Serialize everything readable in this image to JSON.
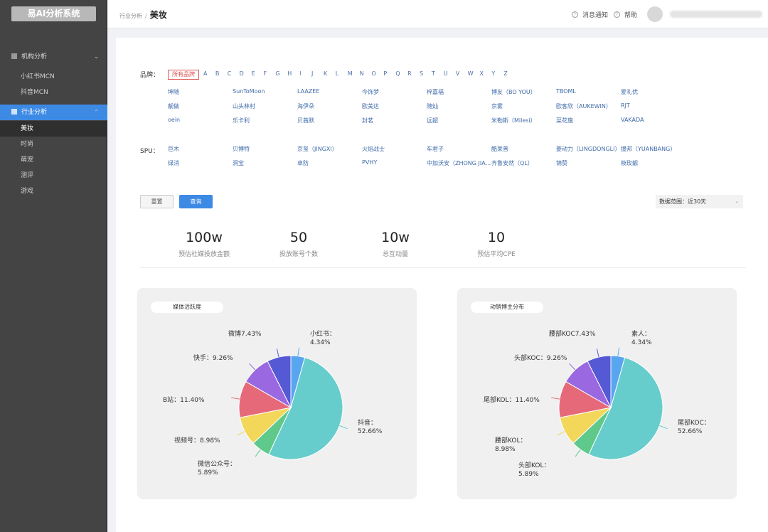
{
  "app": {
    "title": "易AI分析系统"
  },
  "sidebar": {
    "groups": [
      {
        "label": "机构分析",
        "items": [
          "小红书MCN",
          "抖音MCN"
        ]
      },
      {
        "label": "行业分析",
        "items": [
          "美妆",
          "时尚",
          "萌宠",
          "测评",
          "游戏"
        ]
      }
    ],
    "active_item": "美妆"
  },
  "header": {
    "breadcrumb_parent": "行业分析",
    "breadcrumb_separator": "/",
    "breadcrumb_current": "美妆",
    "notify_label": "消息通知",
    "help_label": "帮助"
  },
  "filters": {
    "brand_label": "品牌：",
    "all_brands": "所有品牌",
    "letters": [
      "A",
      "B",
      "C",
      "D",
      "E",
      "F",
      "G",
      "H",
      "I",
      "J",
      "K",
      "L",
      "M",
      "N",
      "O",
      "P",
      "Q",
      "R",
      "S",
      "T",
      "U",
      "V",
      "W",
      "X",
      "Y",
      "Z"
    ],
    "brands": [
      "坤随",
      "SunToMoon",
      "LAAZEE",
      "今饰梦",
      "梓嘉福",
      "博友（BO YOU）",
      "TBOML",
      "爱礼优",
      "靓做",
      "山头林村",
      "海伊朵",
      "欧美达",
      "随灿",
      "京雾",
      "欧客欣（AUKEWIN）",
      "RJT",
      "oein",
      "乐卡利",
      "贝茜默",
      "封茗",
      "远韶",
      "米勒斯（Milesi）",
      "菜花施",
      "VAKADA"
    ],
    "spu_label": "SPU：",
    "spus": [
      "巨木",
      "贝博特",
      "京玺（JINGXI）",
      "火焰战士",
      "车君子",
      "酷莱普",
      "菱动力（LINGDONGLI）",
      "援邦（YUANBANG）",
      "绿消",
      "洞宝",
      "卓防",
      "PVHY",
      "中加沃安（ZHONG JIA...",
      "齐鲁安然（QL）",
      "锦赞",
      "筱玫靓"
    ],
    "reset_label": "重置",
    "query_label": "查询",
    "range_label": "数据范围：近30天"
  },
  "stats": [
    {
      "value": "100w",
      "label": "预估社媒投放金额"
    },
    {
      "value": "50",
      "label": "投放账号个数"
    },
    {
      "value": "10w",
      "label": "总互动量"
    },
    {
      "value": "10",
      "label": "预估平均CPE"
    }
  ],
  "chart_data": [
    {
      "type": "pie",
      "title": "媒体活跃度",
      "labels": [
        "小红书",
        "抖音",
        "微信公众号",
        "视频号",
        "B站",
        "快手",
        "微博"
      ],
      "values": [
        4.34,
        52.66,
        5.89,
        8.98,
        11.4,
        9.26,
        7.43
      ],
      "label_text": [
        "小红书：|4.34%",
        "抖音：|52.66%",
        "微信公众号：|5.89%",
        "视频号：8.98%",
        "B站：11.40%",
        "快手：9.26%",
        "微博7.43%"
      ],
      "colors": [
        "#58a5f0",
        "#66cdcc",
        "#5fc98b",
        "#f3d75a",
        "#e66979",
        "#9a68e0",
        "#5659d4"
      ]
    },
    {
      "type": "pie",
      "title": "动销博主分布",
      "labels": [
        "素人",
        "尾部KOC",
        "头部KOL",
        "腰部KOL",
        "尾部KOL",
        "头部KOC",
        "腰部KOC"
      ],
      "values": [
        4.34,
        52.66,
        5.89,
        8.98,
        11.4,
        9.26,
        7.43
      ],
      "label_text": [
        "素人：|4.34%",
        "尾部KOC：|52.66%",
        "头部KOL：|5.89%",
        "腰部KOL：|8.98%",
        "尾部KOL：11.40%",
        "头部KOC：9.26%",
        "腰部KOC7.43%"
      ],
      "colors": [
        "#58a5f0",
        "#66cdcc",
        "#5fc98b",
        "#f3d75a",
        "#e66979",
        "#9a68e0",
        "#5659d4"
      ]
    }
  ]
}
